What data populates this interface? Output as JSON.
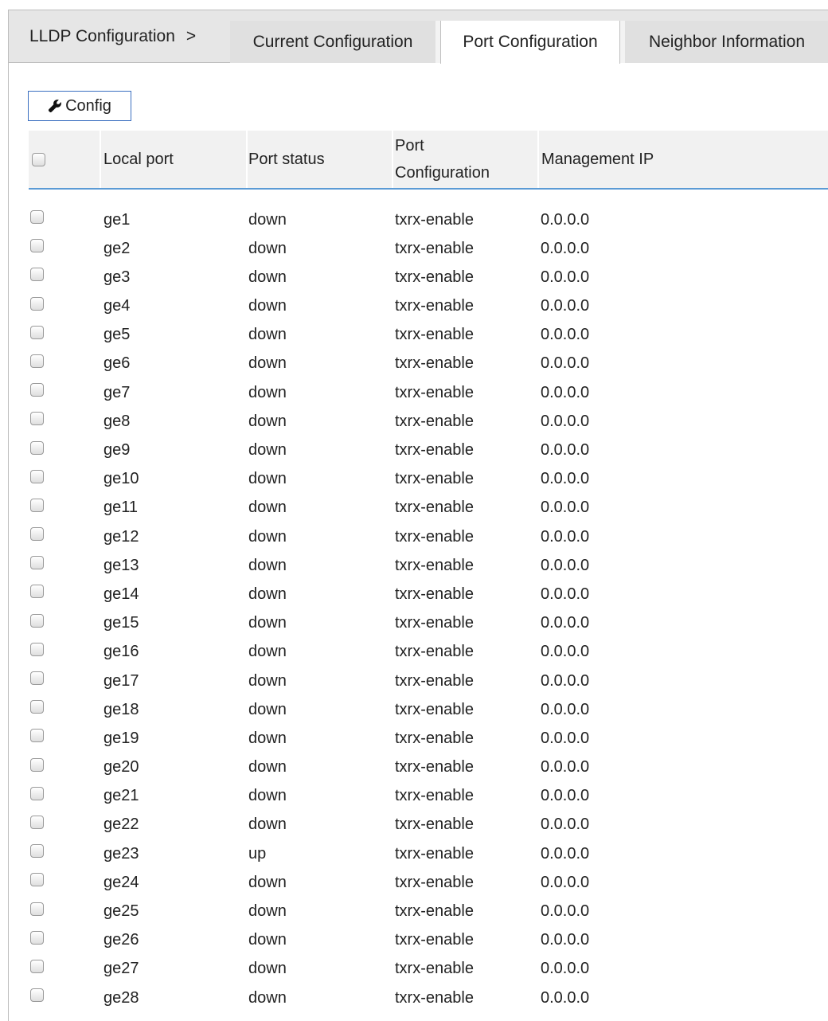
{
  "breadcrumb": {
    "label": "LLDP Configuration",
    "separator": ">"
  },
  "tabs": [
    {
      "label": "Current Configuration",
      "active": false
    },
    {
      "label": "Port Configuration",
      "active": true
    },
    {
      "label": "Neighbor Information",
      "active": false
    }
  ],
  "toolbar": {
    "config_label": "Config",
    "config_icon": "wrench-icon"
  },
  "table": {
    "headers": {
      "local_port": "Local port",
      "port_status": "Port status",
      "port_configuration_line1": "Port",
      "port_configuration_line2": "Configuration",
      "management_ip": "Management IP"
    },
    "rows": [
      {
        "port": "ge1",
        "status": "down",
        "config": "txrx-enable",
        "ip": "0.0.0.0"
      },
      {
        "port": "ge2",
        "status": "down",
        "config": "txrx-enable",
        "ip": "0.0.0.0"
      },
      {
        "port": "ge3",
        "status": "down",
        "config": "txrx-enable",
        "ip": "0.0.0.0"
      },
      {
        "port": "ge4",
        "status": "down",
        "config": "txrx-enable",
        "ip": "0.0.0.0"
      },
      {
        "port": "ge5",
        "status": "down",
        "config": "txrx-enable",
        "ip": "0.0.0.0"
      },
      {
        "port": "ge6",
        "status": "down",
        "config": "txrx-enable",
        "ip": "0.0.0.0"
      },
      {
        "port": "ge7",
        "status": "down",
        "config": "txrx-enable",
        "ip": "0.0.0.0"
      },
      {
        "port": "ge8",
        "status": "down",
        "config": "txrx-enable",
        "ip": "0.0.0.0"
      },
      {
        "port": "ge9",
        "status": "down",
        "config": "txrx-enable",
        "ip": "0.0.0.0"
      },
      {
        "port": "ge10",
        "status": "down",
        "config": "txrx-enable",
        "ip": "0.0.0.0"
      },
      {
        "port": "ge11",
        "status": "down",
        "config": "txrx-enable",
        "ip": "0.0.0.0"
      },
      {
        "port": "ge12",
        "status": "down",
        "config": "txrx-enable",
        "ip": "0.0.0.0"
      },
      {
        "port": "ge13",
        "status": "down",
        "config": "txrx-enable",
        "ip": "0.0.0.0"
      },
      {
        "port": "ge14",
        "status": "down",
        "config": "txrx-enable",
        "ip": "0.0.0.0"
      },
      {
        "port": "ge15",
        "status": "down",
        "config": "txrx-enable",
        "ip": "0.0.0.0"
      },
      {
        "port": "ge16",
        "status": "down",
        "config": "txrx-enable",
        "ip": "0.0.0.0"
      },
      {
        "port": "ge17",
        "status": "down",
        "config": "txrx-enable",
        "ip": "0.0.0.0"
      },
      {
        "port": "ge18",
        "status": "down",
        "config": "txrx-enable",
        "ip": "0.0.0.0"
      },
      {
        "port": "ge19",
        "status": "down",
        "config": "txrx-enable",
        "ip": "0.0.0.0"
      },
      {
        "port": "ge20",
        "status": "down",
        "config": "txrx-enable",
        "ip": "0.0.0.0"
      },
      {
        "port": "ge21",
        "status": "down",
        "config": "txrx-enable",
        "ip": "0.0.0.0"
      },
      {
        "port": "ge22",
        "status": "down",
        "config": "txrx-enable",
        "ip": "0.0.0.0"
      },
      {
        "port": "ge23",
        "status": "up",
        "config": "txrx-enable",
        "ip": "0.0.0.0"
      },
      {
        "port": "ge24",
        "status": "down",
        "config": "txrx-enable",
        "ip": "0.0.0.0"
      },
      {
        "port": "ge25",
        "status": "down",
        "config": "txrx-enable",
        "ip": "0.0.0.0"
      },
      {
        "port": "ge26",
        "status": "down",
        "config": "txrx-enable",
        "ip": "0.0.0.0"
      },
      {
        "port": "ge27",
        "status": "down",
        "config": "txrx-enable",
        "ip": "0.0.0.0"
      },
      {
        "port": "ge28",
        "status": "down",
        "config": "txrx-enable",
        "ip": "0.0.0.0"
      }
    ]
  },
  "colors": {
    "header_underline": "#5b9bd5",
    "button_border": "#3a6fc0",
    "tabbar_bg": "#e6e6e6"
  }
}
